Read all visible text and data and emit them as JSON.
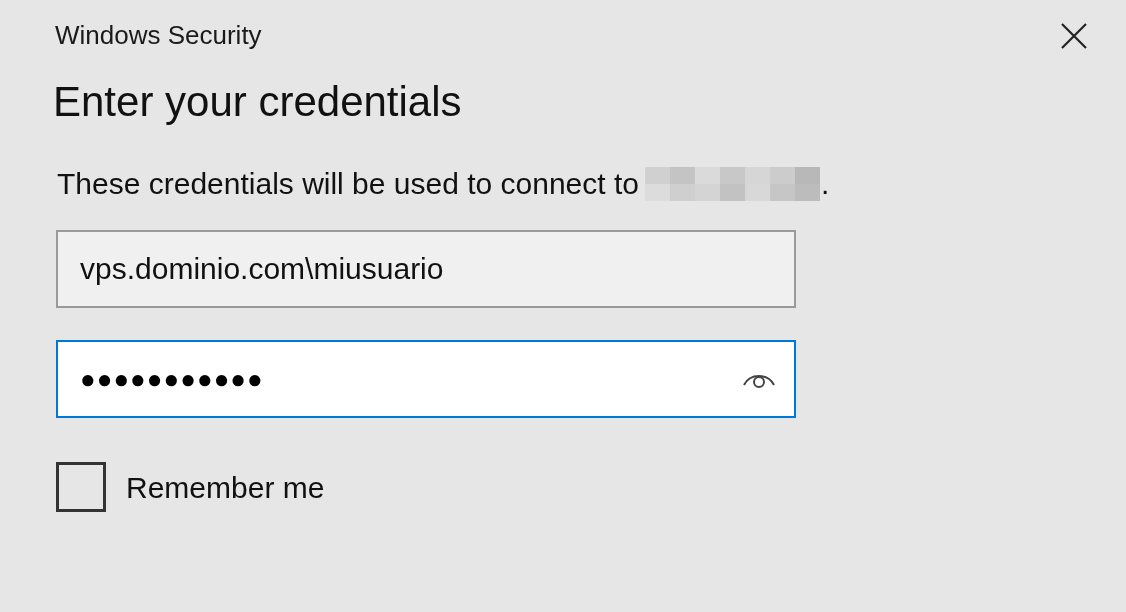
{
  "window": {
    "title": "Windows Security"
  },
  "heading": "Enter your credentials",
  "message": {
    "text": "These credentials will be used to connect to",
    "suffix": "."
  },
  "username": {
    "value": "vps.dominio.com\\miusuario"
  },
  "password": {
    "value": "●●●●●●●●●●●",
    "focused": true
  },
  "remember": {
    "label": "Remember me",
    "checked": false
  }
}
